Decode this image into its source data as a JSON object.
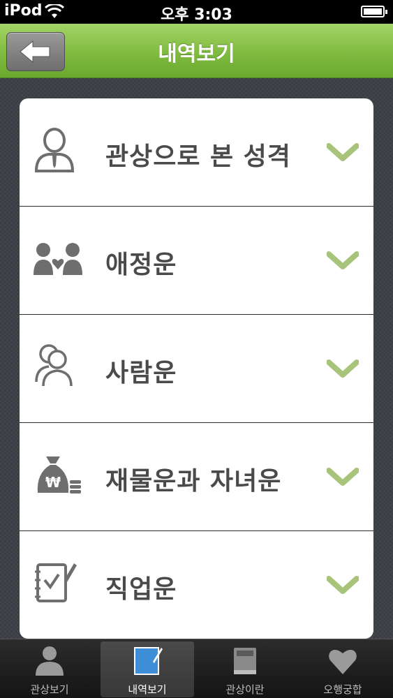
{
  "status_bar": {
    "carrier": "iPod",
    "time": "오후 3:03"
  },
  "nav": {
    "title": "내역보기",
    "back_icon": "arrow-left-icon"
  },
  "list": {
    "items": [
      {
        "label": "관상으로 본 성격",
        "icon": "person-tie-icon"
      },
      {
        "label": "애정운",
        "icon": "couple-heart-icon"
      },
      {
        "label": "사람운",
        "icon": "people-icon"
      },
      {
        "label": "재물운과 자녀운",
        "icon": "money-bag-icon"
      },
      {
        "label": "직업운",
        "icon": "notebook-pen-icon"
      }
    ],
    "chevron_color": "#a8c47a"
  },
  "tabs": [
    {
      "label": "관상보기",
      "icon": "person-icon",
      "selected": false
    },
    {
      "label": "내역보기",
      "icon": "notepad-icon",
      "selected": true
    },
    {
      "label": "관상이란",
      "icon": "book-icon",
      "selected": false
    },
    {
      "label": "오행궁합",
      "icon": "heart-icon",
      "selected": false
    }
  ],
  "colors": {
    "nav_green": "#7fbb3f",
    "label_gray": "#4a4a4a",
    "icon_gray": "#6e6e6e"
  }
}
